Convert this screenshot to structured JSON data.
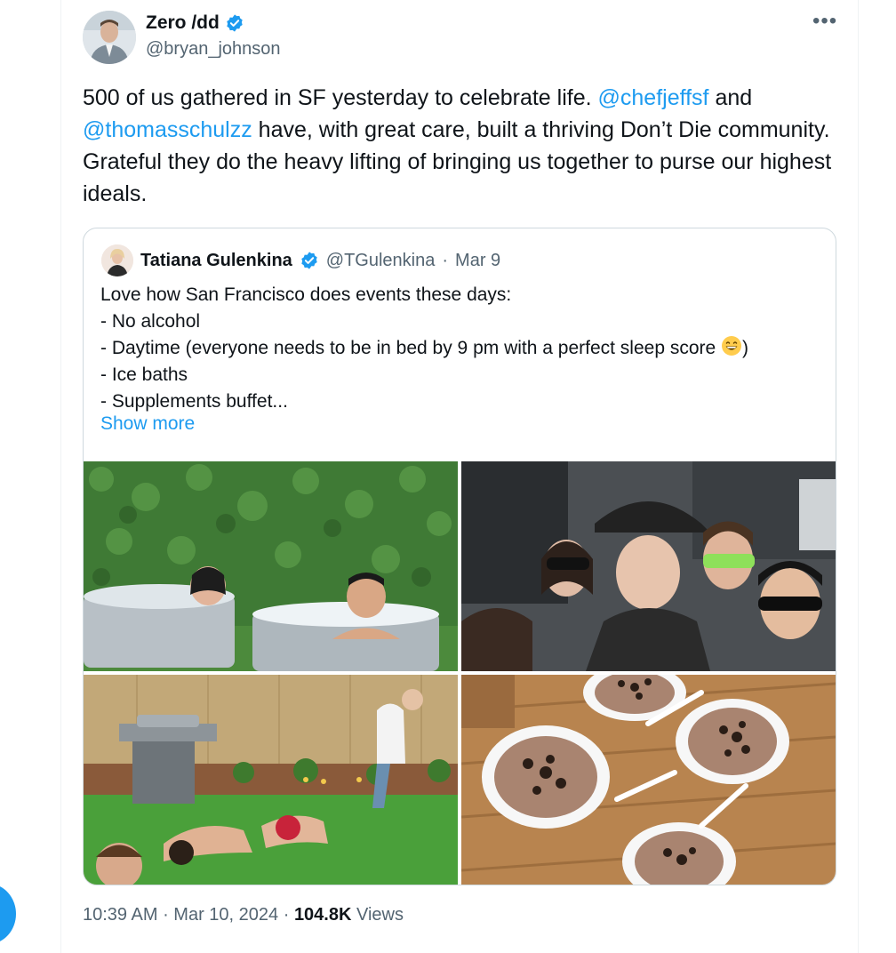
{
  "author": {
    "display_name": "Zero /dd",
    "handle": "@bryan_johnson",
    "verified": true,
    "avatar_icon": "profile-photo"
  },
  "tweet": {
    "text_part1": "500 of us gathered in SF yesterday to celebrate life. ",
    "mention1": "@chefjeffsf",
    "text_part2": " and ",
    "mention2": "@thomasschulzz",
    "text_part3": " have, with great care, built a thriving Don’t Die community. Grateful they do the heavy lifting of bringing us together to purse our highest ideals."
  },
  "quote": {
    "display_name": "Tatiana Gulenkina",
    "handle": "@TGulenkina",
    "separator": "·",
    "date": "Mar 9",
    "lines": [
      "Love how San Francisco does events these days:",
      "- No alcohol",
      "- Daytime (everyone needs to be in bed by 9 pm with a perfect sleep score ",
      "- Ice baths",
      "- Supplements buffet..."
    ],
    "line3_suffix": ")",
    "emoji_icon": "grinning-face-emoji",
    "show_more": "Show more",
    "photos": [
      "ice-bath-photo",
      "group-selfie-photo",
      "pushups-photo",
      "dessert-cups-photo"
    ]
  },
  "footer": {
    "time": "10:39 AM",
    "sep1": " · ",
    "date": "Mar 10, 2024",
    "sep2": " · ",
    "views_count": "104.8K",
    "views_label": " Views"
  },
  "colors": {
    "accent": "#1d9bf0",
    "text": "#0f1419",
    "secondary": "#536471",
    "border": "#cfd9de"
  }
}
